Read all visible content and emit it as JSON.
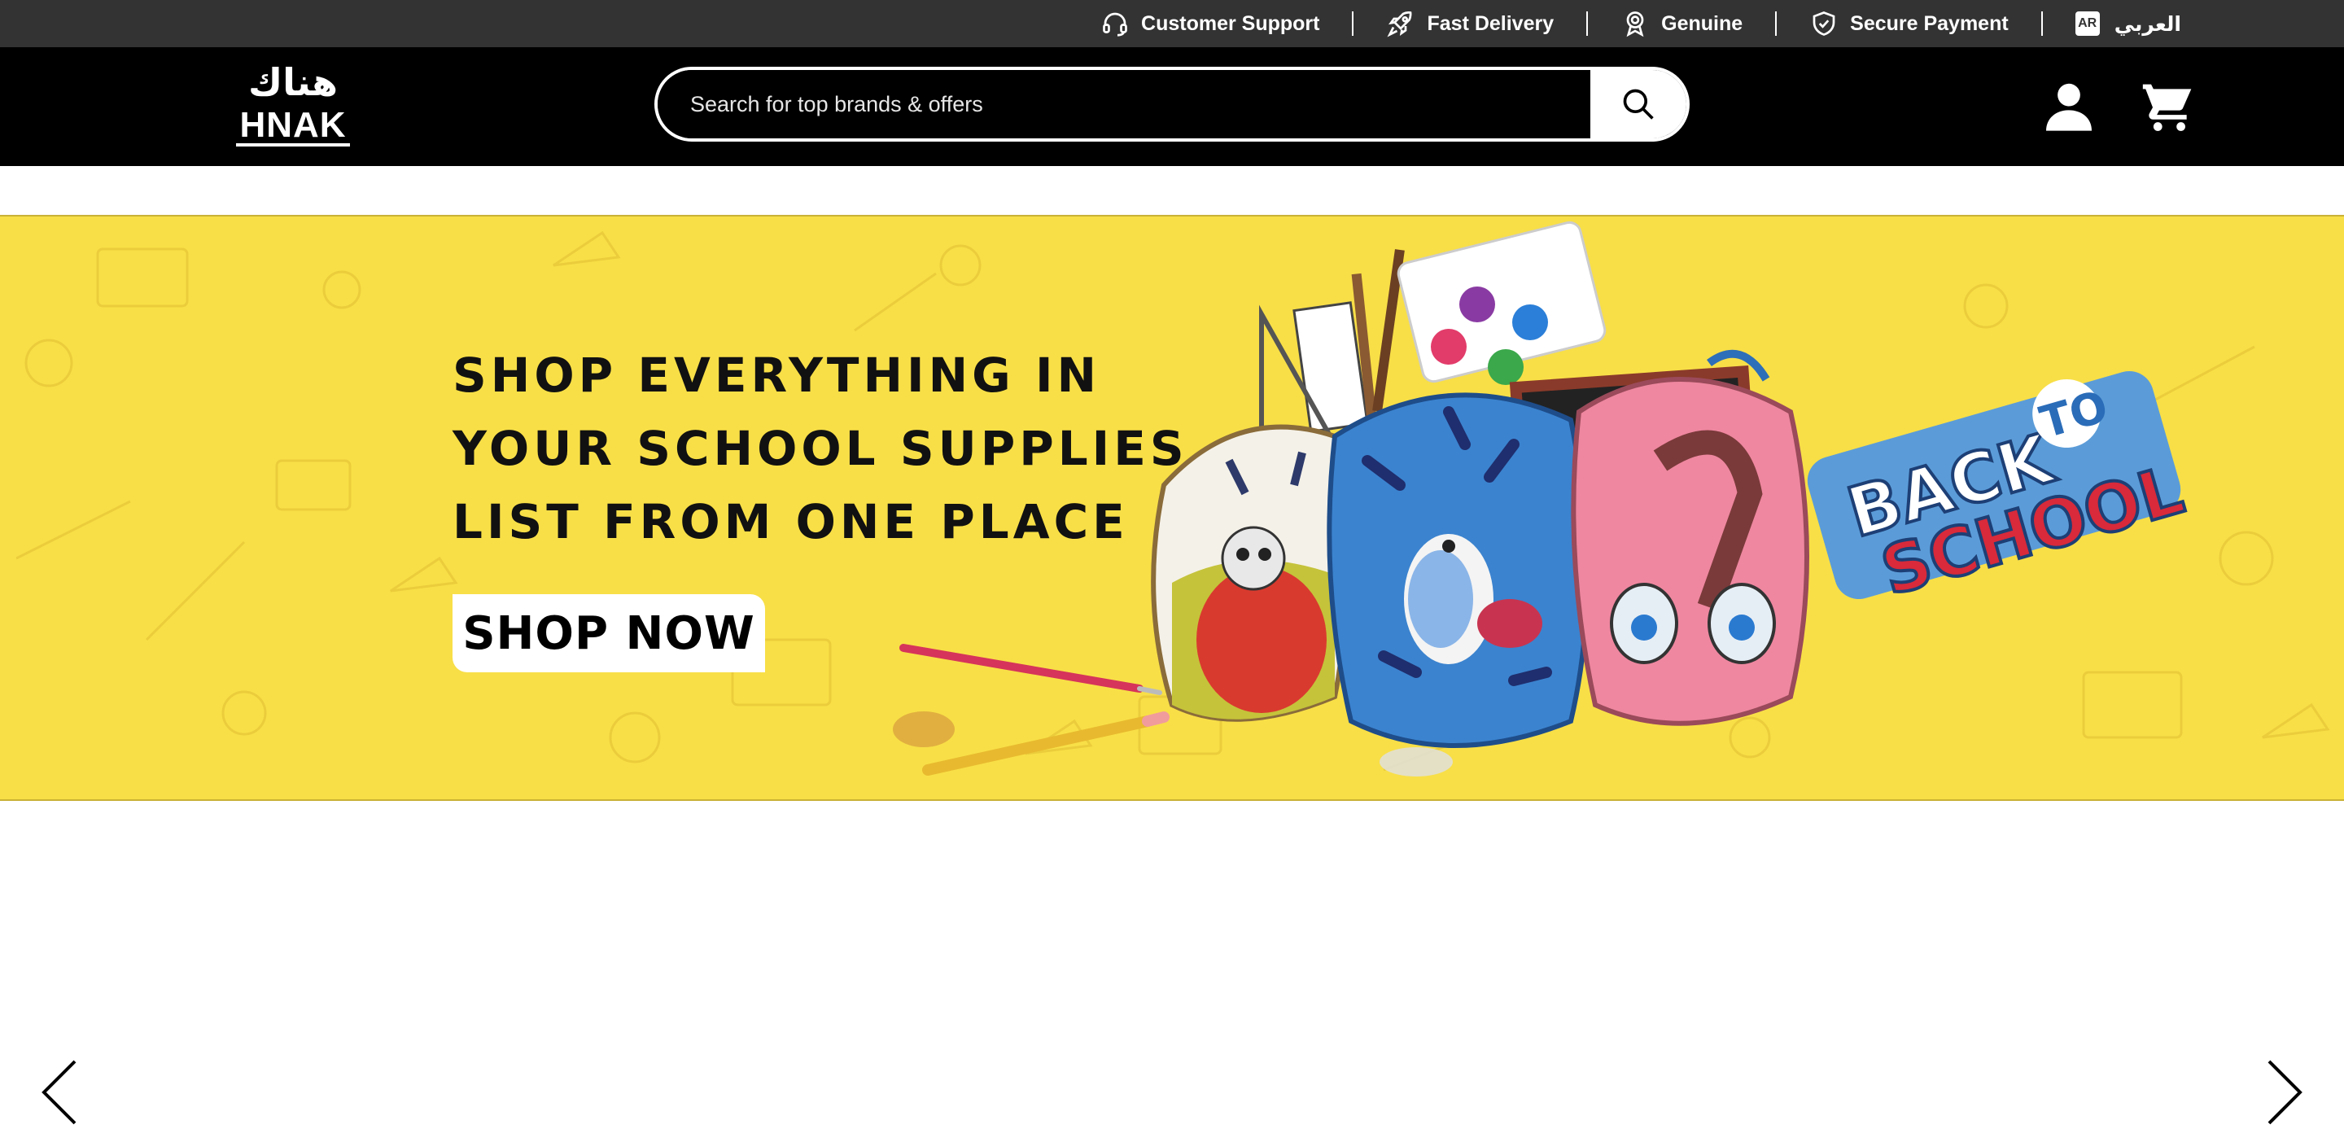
{
  "topbar": {
    "items": [
      {
        "label": "Customer Support",
        "icon": "headset-icon"
      },
      {
        "label": "Fast Delivery",
        "icon": "rocket-icon"
      },
      {
        "label": "Genuine",
        "icon": "award-badge-icon"
      },
      {
        "label": "Secure Payment",
        "icon": "shield-check-icon"
      }
    ],
    "language": {
      "badge": "AR",
      "label": "العربي"
    }
  },
  "header": {
    "logo_ar": "هناك",
    "logo_en": "HNAK",
    "search_placeholder": "Search for top brands & offers",
    "user_icon": "user-icon",
    "cart_icon": "cart-icon"
  },
  "banner": {
    "headline": [
      "SHOP EVERYTHING IN",
      "YOUR SCHOOL SUPPLIES",
      "LIST FROM ONE PLACE"
    ],
    "cta": "SHOP NOW",
    "badge_line1": "BACK",
    "badge_line2": "TO",
    "badge_line3": "SCHOOL",
    "background_color": "#f8df47"
  },
  "carousel": {
    "prev_icon": "chevron-left-icon",
    "next_icon": "chevron-right-icon"
  },
  "colors": {
    "topbar": "#333333",
    "header": "#000000",
    "accent_yellow": "#f8df47",
    "text_light": "#ffffff"
  }
}
